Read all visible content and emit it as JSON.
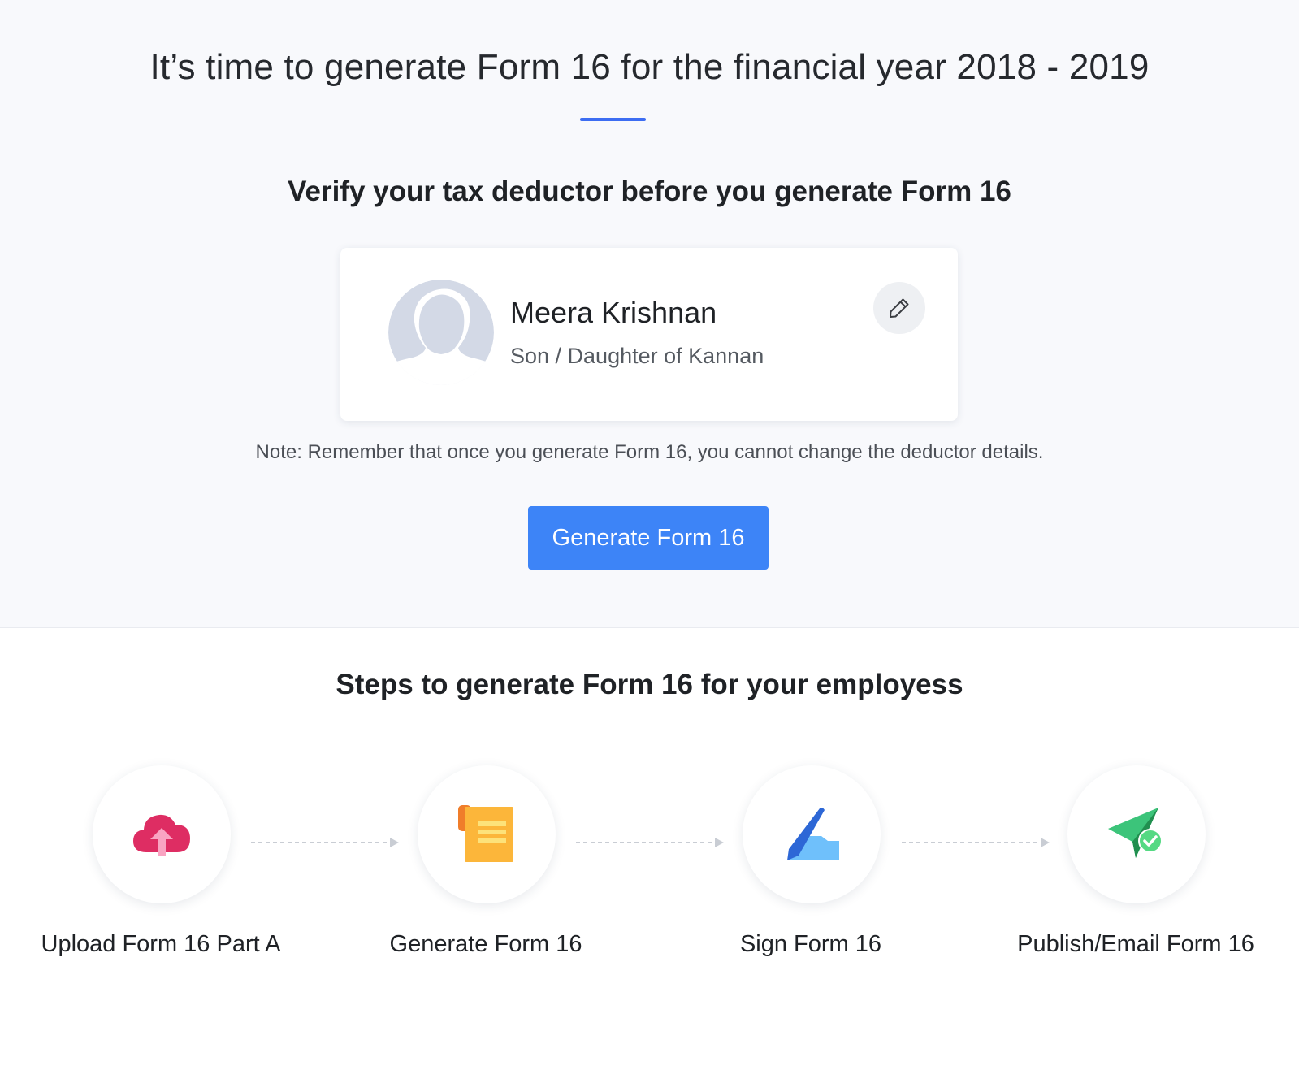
{
  "header": {
    "title": "It’s time to generate Form 16 for the financial year 2018 - 2019"
  },
  "verify": {
    "heading": "Verify your tax deductor before you generate Form 16",
    "deductor": {
      "name": "Meera Krishnan",
      "relation": "Son / Daughter of Kannan"
    },
    "note": "Note: Remember that once you generate Form 16, you cannot change the deductor details.",
    "generate_button_label": "Generate Form 16"
  },
  "steps": {
    "heading": "Steps to generate Form 16 for your employess",
    "items": [
      {
        "label": "Upload Form 16 Part A",
        "icon": "cloud-upload-icon"
      },
      {
        "label": "Generate Form 16",
        "icon": "document-scroll-icon"
      },
      {
        "label": "Sign Form 16",
        "icon": "pen-sign-icon"
      },
      {
        "label": "Publish/Email Form 16",
        "icon": "paper-plane-check-icon"
      }
    ]
  },
  "colors": {
    "accent": "#3d6df2",
    "button": "#3d84f7",
    "top_background": "#f8f9fc"
  }
}
